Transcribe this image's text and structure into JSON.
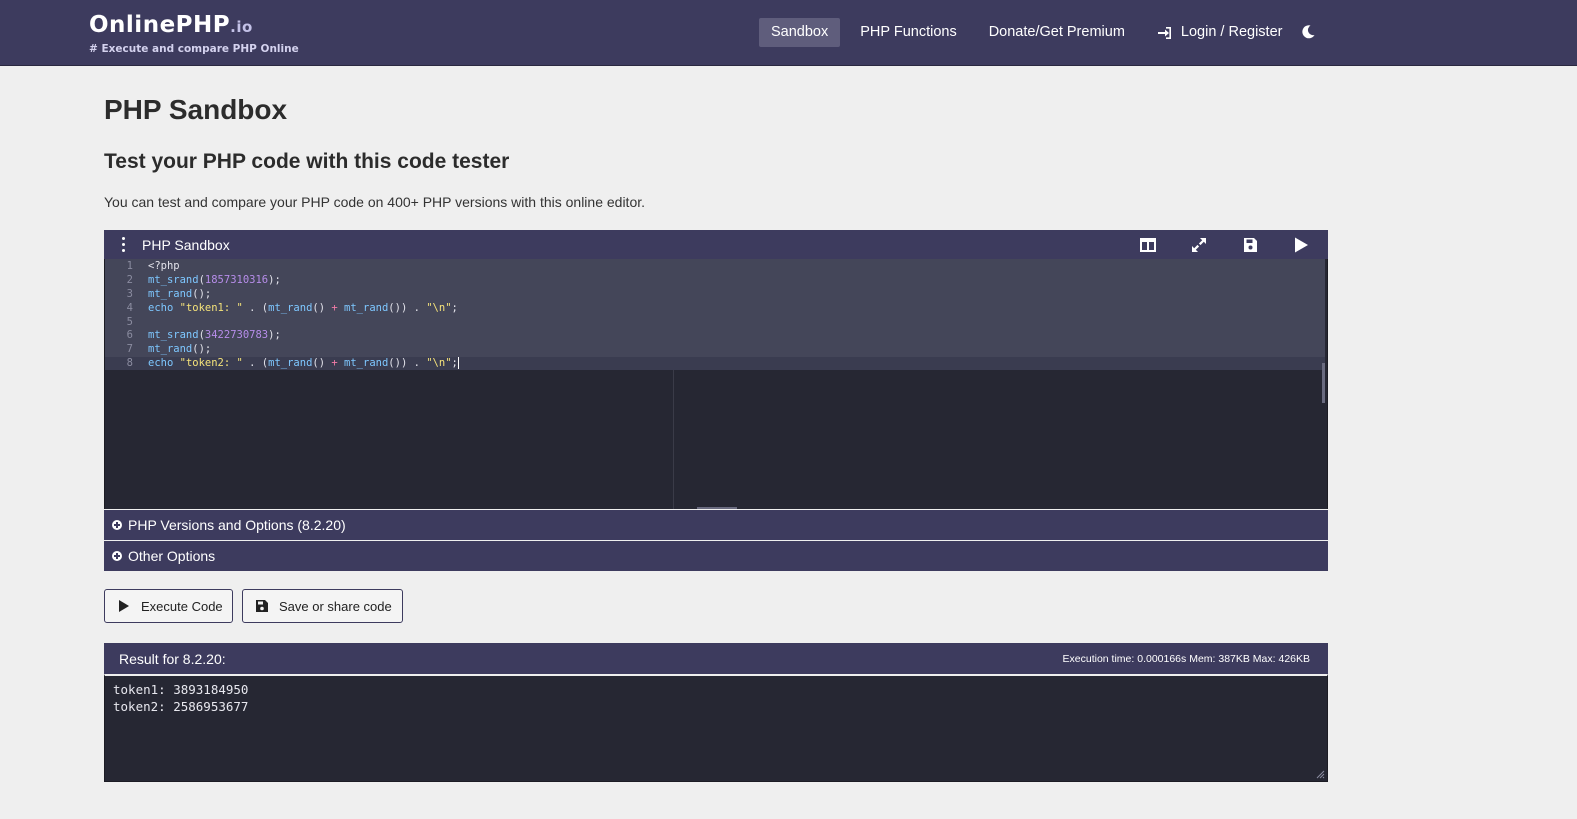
{
  "brand": {
    "name": "OnlinePHP",
    "tld": ".io",
    "tagline": "# Execute and compare PHP Online"
  },
  "nav": {
    "sandbox": "Sandbox",
    "functions": "PHP Functions",
    "donate": "Donate/Get Premium",
    "login": "Login / Register",
    "login_icon": "sign-in-icon",
    "theme_icon": "moon-icon"
  },
  "page": {
    "title": "PHP Sandbox",
    "subtitle": "Test your PHP code with this code tester",
    "description": "You can test and compare your PHP code on 400+ PHP versions with this online editor."
  },
  "editor": {
    "title": "PHP Sandbox",
    "toolbar_icons": [
      "split-view-icon",
      "expand-icon",
      "save-icon",
      "play-icon"
    ],
    "line_numbers": [
      "1",
      "2",
      "3",
      "4",
      "5",
      "6",
      "7",
      "8"
    ],
    "lines": [
      "<?php",
      "mt_srand(1857310316);",
      "mt_rand();",
      "echo \"token1: \" . (mt_rand() + mt_rand()) . \"\\n\";",
      "",
      "mt_srand(3422730783);",
      "mt_rand();",
      "echo \"token2: \" . (mt_rand() + mt_rand()) . \"\\n\";"
    ]
  },
  "options": {
    "versions_label": "PHP Versions and Options (8.2.20)",
    "other_label": "Other Options"
  },
  "buttons": {
    "execute": "Execute Code",
    "save": "Save or share code"
  },
  "result": {
    "title": "Result for 8.2.20:",
    "meta": "Execution time: 0.000166s Mem: 387KB Max: 426KB",
    "output": [
      "token1: 3893184950",
      "token2: 2586953677"
    ]
  },
  "colors": {
    "navbar": "#3d3b5e",
    "editor_bg": "#262733",
    "page_bg": "#efefef"
  }
}
